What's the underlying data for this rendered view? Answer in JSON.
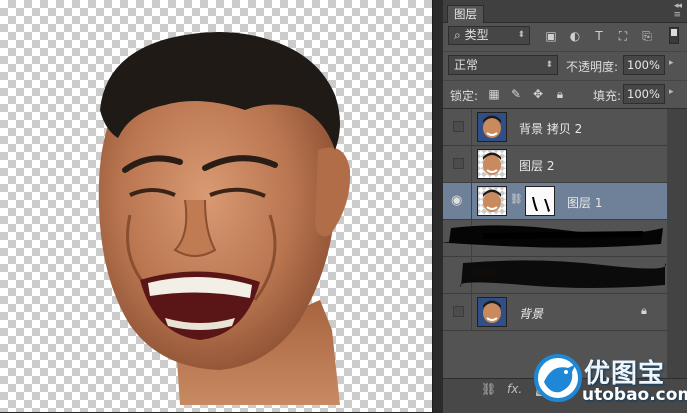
{
  "panel": {
    "tab_label": "图层",
    "filter": {
      "kind": "类型",
      "icons": [
        "image-filter-icon",
        "adjustment-filter-icon",
        "type-filter-icon",
        "shape-filter-icon",
        "smart-object-filter-icon"
      ]
    },
    "blend_mode": "正常",
    "opacity_label": "不透明度:",
    "opacity_value": "100%",
    "lock_label": "锁定:",
    "fill_label": "填充:",
    "fill_value": "100%",
    "layers": [
      {
        "name": "背景 拷贝 2",
        "visible": false,
        "selected": false,
        "has_mask": false,
        "locked": false
      },
      {
        "name": "图层 2",
        "visible": false,
        "selected": false,
        "has_mask": false,
        "locked": false
      },
      {
        "name": "图层 1",
        "visible": true,
        "selected": true,
        "has_mask": true,
        "locked": false
      },
      {
        "name": "",
        "redacted": true
      },
      {
        "name": "",
        "redacted": true
      },
      {
        "name": "背景",
        "visible": false,
        "selected": false,
        "has_mask": false,
        "locked": true
      }
    ],
    "bottom_icons": [
      "link-layers-icon",
      "fx-icon",
      "add-mask-icon"
    ],
    "bottom_fx": "fx."
  },
  "watermark": {
    "brand": "优图宝",
    "url": "utobao.com"
  },
  "colors": {
    "panel_bg": "#535353",
    "selected_row": "#6f8198",
    "tab_bar": "#404040",
    "workspace": "#282828",
    "watermark_blue": "#1e88d6"
  }
}
